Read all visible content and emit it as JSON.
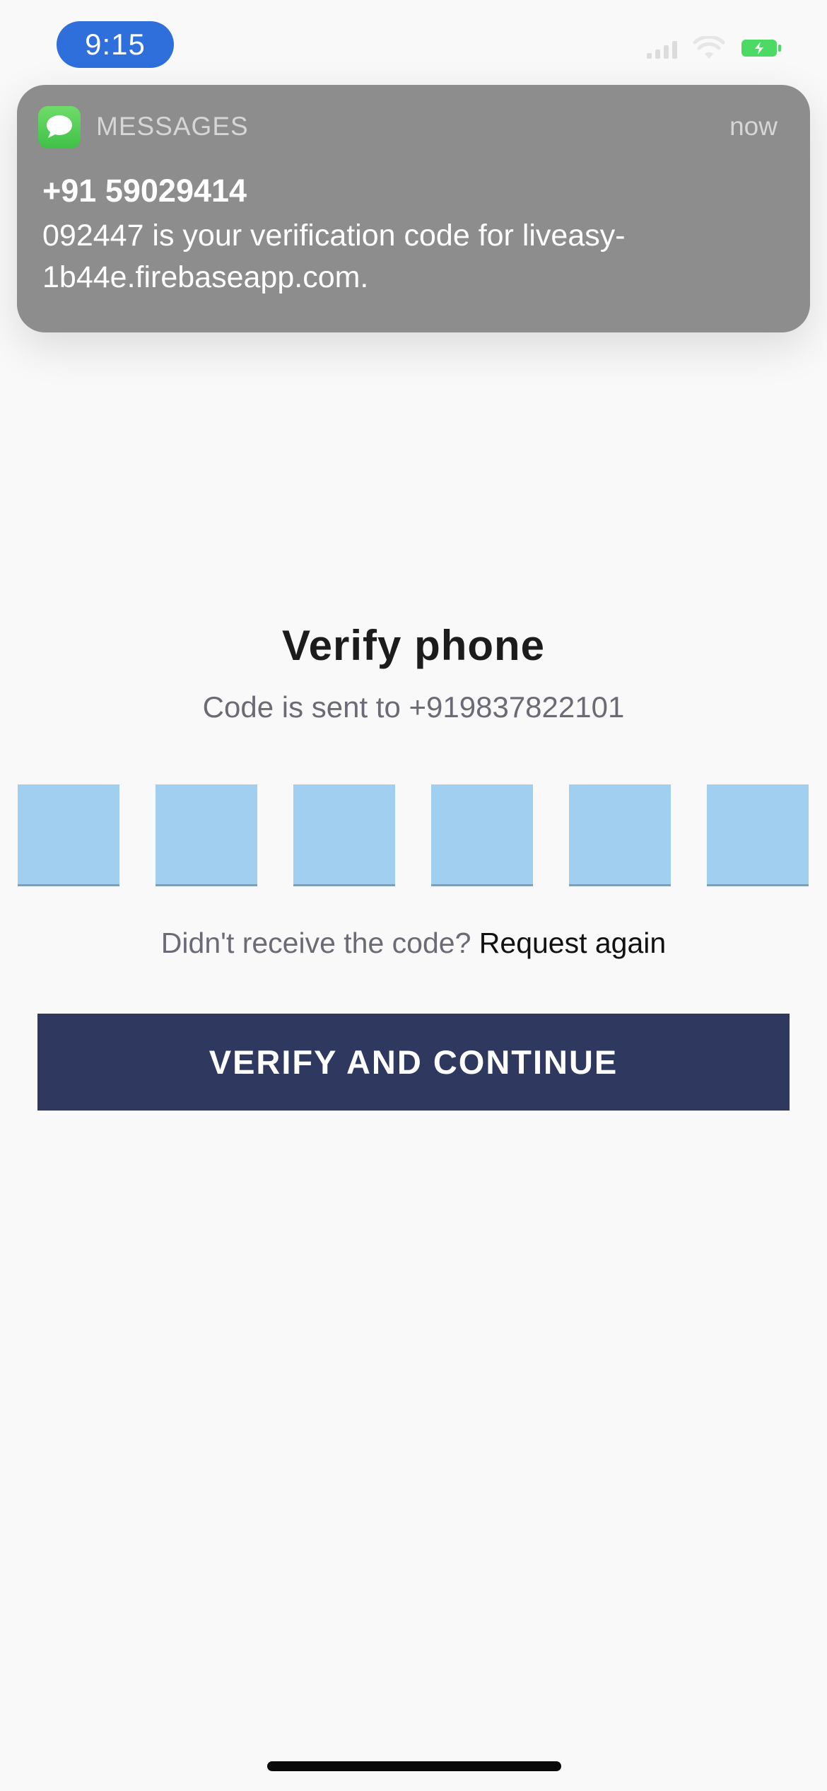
{
  "status_bar": {
    "time": "9:15",
    "icons": [
      "signal-icon",
      "wifi-icon",
      "battery-charging-icon"
    ],
    "time_pill_color": "#2f6fdc",
    "battery_color": "#4cd964"
  },
  "notification": {
    "app_name": "MESSAGES",
    "app_icon": "messages-app-icon",
    "time": "now",
    "sender": "+91 59029414",
    "body": "092447 is your verification code for liveasy-1b44e.firebaseapp.com."
  },
  "verify": {
    "title": "Verify phone",
    "subtitle": "Code is sent to +919837822101",
    "code_digits": [
      "",
      "",
      "",
      "",
      "",
      ""
    ],
    "resend_prompt": "Didn't receive the code?",
    "resend_link": "Request again",
    "button_label": "VERIFY AND CONTINUE",
    "colors": {
      "code_box": "#a0cfef",
      "button": "#2f385e"
    }
  }
}
